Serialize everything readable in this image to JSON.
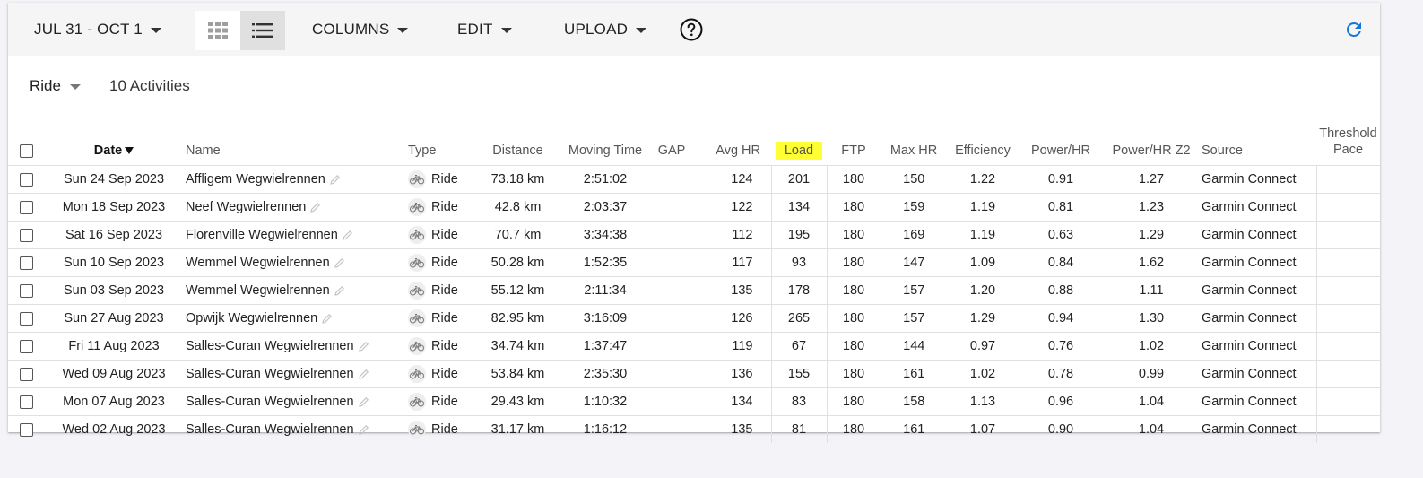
{
  "toolbar": {
    "date_range": "JUL 31 - OCT 1",
    "columns": "COLUMNS",
    "edit": "EDIT",
    "upload": "UPLOAD"
  },
  "filter": {
    "type": "Ride",
    "count": "10 Activities"
  },
  "columns": {
    "date": "Date",
    "name": "Name",
    "type": "Type",
    "distance": "Distance",
    "moving_time": "Moving Time",
    "gap": "GAP",
    "avg_hr": "Avg HR",
    "load": "Load",
    "ftp": "FTP",
    "max_hr": "Max HR",
    "efficiency": "Efficiency",
    "power_hr": "Power/HR",
    "power_hr_z2": "Power/HR Z2",
    "source": "Source",
    "threshold_pace": "Threshold Pace"
  },
  "colors": {
    "highlight": "#ffff33",
    "accent": "#1976d2"
  },
  "rows": [
    {
      "date": "Sun 24 Sep 2023",
      "name": "Affligem Wegwielrennen",
      "type": "Ride",
      "distance": "73.18 km",
      "moving_time": "2:51:02",
      "gap": "",
      "avg_hr": "124",
      "load": "201",
      "ftp": "180",
      "max_hr": "150",
      "efficiency": "1.22",
      "power_hr": "0.91",
      "power_hr_z2": "1.27",
      "source": "Garmin Connect",
      "threshold_pace": ""
    },
    {
      "date": "Mon 18 Sep 2023",
      "name": "Neef Wegwielrennen",
      "type": "Ride",
      "distance": "42.8 km",
      "moving_time": "2:03:37",
      "gap": "",
      "avg_hr": "122",
      "load": "134",
      "ftp": "180",
      "max_hr": "159",
      "efficiency": "1.19",
      "power_hr": "0.81",
      "power_hr_z2": "1.23",
      "source": "Garmin Connect",
      "threshold_pace": ""
    },
    {
      "date": "Sat 16 Sep 2023",
      "name": "Florenville Wegwielrennen",
      "type": "Ride",
      "distance": "70.7 km",
      "moving_time": "3:34:38",
      "gap": "",
      "avg_hr": "112",
      "load": "195",
      "ftp": "180",
      "max_hr": "169",
      "efficiency": "1.19",
      "power_hr": "0.63",
      "power_hr_z2": "1.29",
      "source": "Garmin Connect",
      "threshold_pace": ""
    },
    {
      "date": "Sun 10 Sep 2023",
      "name": "Wemmel Wegwielrennen",
      "type": "Ride",
      "distance": "50.28 km",
      "moving_time": "1:52:35",
      "gap": "",
      "avg_hr": "117",
      "load": "93",
      "ftp": "180",
      "max_hr": "147",
      "efficiency": "1.09",
      "power_hr": "0.84",
      "power_hr_z2": "1.62",
      "source": "Garmin Connect",
      "threshold_pace": ""
    },
    {
      "date": "Sun 03 Sep 2023",
      "name": "Wemmel Wegwielrennen",
      "type": "Ride",
      "distance": "55.12 km",
      "moving_time": "2:11:34",
      "gap": "",
      "avg_hr": "135",
      "load": "178",
      "ftp": "180",
      "max_hr": "157",
      "efficiency": "1.20",
      "power_hr": "0.88",
      "power_hr_z2": "1.11",
      "source": "Garmin Connect",
      "threshold_pace": ""
    },
    {
      "date": "Sun 27 Aug 2023",
      "name": "Opwijk Wegwielrennen",
      "type": "Ride",
      "distance": "82.95 km",
      "moving_time": "3:16:09",
      "gap": "",
      "avg_hr": "126",
      "load": "265",
      "ftp": "180",
      "max_hr": "157",
      "efficiency": "1.29",
      "power_hr": "0.94",
      "power_hr_z2": "1.30",
      "source": "Garmin Connect",
      "threshold_pace": ""
    },
    {
      "date": "Fri 11 Aug 2023",
      "name": "Salles-Curan Wegwielrennen",
      "type": "Ride",
      "distance": "34.74 km",
      "moving_time": "1:37:47",
      "gap": "",
      "avg_hr": "119",
      "load": "67",
      "ftp": "180",
      "max_hr": "144",
      "efficiency": "0.97",
      "power_hr": "0.76",
      "power_hr_z2": "1.02",
      "source": "Garmin Connect",
      "threshold_pace": ""
    },
    {
      "date": "Wed 09 Aug 2023",
      "name": "Salles-Curan Wegwielrennen",
      "type": "Ride",
      "distance": "53.84 km",
      "moving_time": "2:35:30",
      "gap": "",
      "avg_hr": "136",
      "load": "155",
      "ftp": "180",
      "max_hr": "161",
      "efficiency": "1.02",
      "power_hr": "0.78",
      "power_hr_z2": "0.99",
      "source": "Garmin Connect",
      "threshold_pace": ""
    },
    {
      "date": "Mon 07 Aug 2023",
      "name": "Salles-Curan Wegwielrennen",
      "type": "Ride",
      "distance": "29.43 km",
      "moving_time": "1:10:32",
      "gap": "",
      "avg_hr": "134",
      "load": "83",
      "ftp": "180",
      "max_hr": "158",
      "efficiency": "1.13",
      "power_hr": "0.96",
      "power_hr_z2": "1.04",
      "source": "Garmin Connect",
      "threshold_pace": ""
    },
    {
      "date": "Wed 02 Aug 2023",
      "name": "Salles-Curan Wegwielrennen",
      "type": "Ride",
      "distance": "31.17 km",
      "moving_time": "1:16:12",
      "gap": "",
      "avg_hr": "135",
      "load": "81",
      "ftp": "180",
      "max_hr": "161",
      "efficiency": "1.07",
      "power_hr": "0.90",
      "power_hr_z2": "1.04",
      "source": "Garmin Connect",
      "threshold_pace": ""
    }
  ]
}
